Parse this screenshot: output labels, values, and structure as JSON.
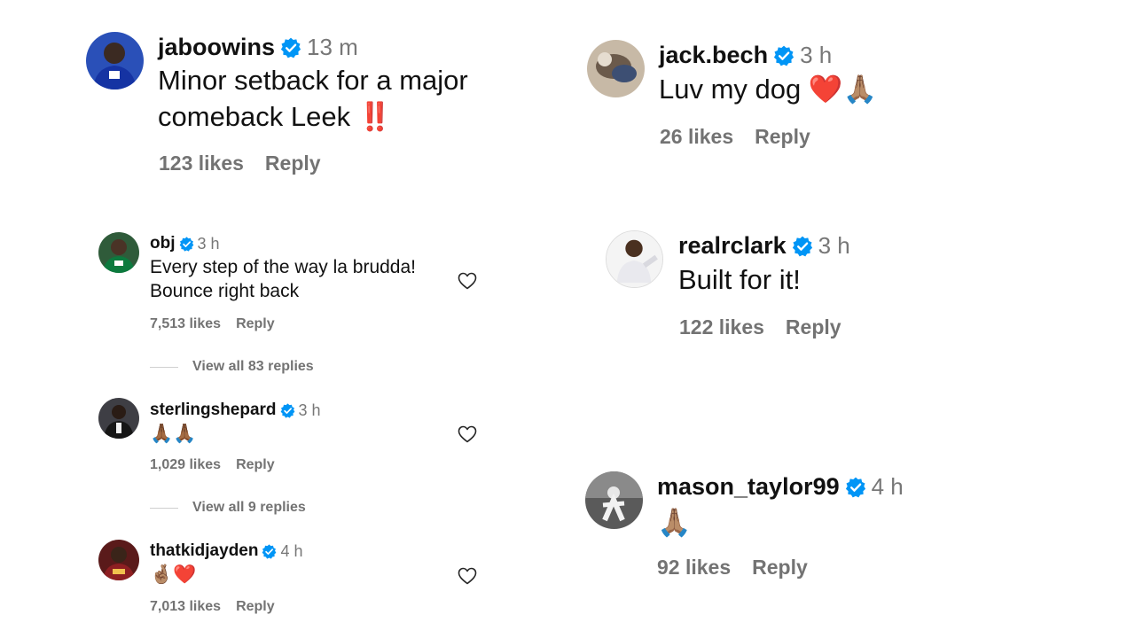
{
  "comments": [
    {
      "username": "jaboowins",
      "time": "13 m",
      "text_line1": "Minor setback for a major",
      "text_line2": "comeback Leek",
      "emoji": "‼️",
      "likes": "123 likes",
      "reply": "Reply"
    },
    {
      "username": "jack.bech",
      "time": "3 h",
      "text": "Luv my dog",
      "emoji": "❤️🙏🏽",
      "likes": "26 likes",
      "reply": "Reply"
    },
    {
      "username": "obj",
      "time": "3 h",
      "text_line1": "Every step of the way la brudda!",
      "text_line2": "Bounce right back",
      "likes": "7,513 likes",
      "reply": "Reply",
      "view_replies": "View all 83 replies"
    },
    {
      "username": "realrclark",
      "time": "3 h",
      "text": "Built for it!",
      "likes": "122 likes",
      "reply": "Reply"
    },
    {
      "username": "sterlingshepard",
      "time": "3 h",
      "emoji": "🙏🏾🙏🏾",
      "likes": "1,029 likes",
      "reply": "Reply",
      "view_replies": "View all 9 replies"
    },
    {
      "username": "mason_taylor99",
      "time": "4 h",
      "emoji": "🙏🏽",
      "likes": "92 likes",
      "reply": "Reply"
    },
    {
      "username": "thatkidjayden",
      "time": "4 h",
      "emoji": "🤞🏽❤️",
      "likes": "7,013 likes",
      "reply": "Reply"
    }
  ],
  "icons": {
    "verified": "verified-badge-icon",
    "like": "heart-outline-icon"
  },
  "colors": {
    "verified": "#0095f6",
    "muted": "#737373",
    "text": "#111111"
  }
}
